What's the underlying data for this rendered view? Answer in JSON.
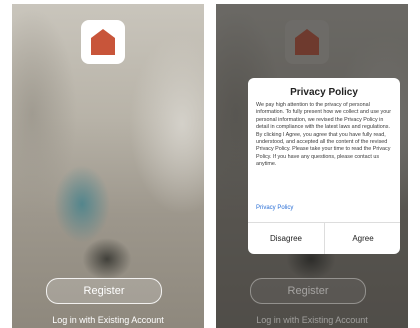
{
  "left_screen": {
    "register_label": "Register",
    "login_label": "Log in with Existing Account"
  },
  "right_screen": {
    "register_label": "Register",
    "login_label": "Log in with Existing Account",
    "dialog": {
      "title": "Privacy Policy",
      "body": "We pay high attention to the privacy of personal information. To fully present how we collect and use your personal information, we revised the Privacy Policy in detail in compliance with the latest laws and regulations. By clicking I Agree, you agree that you have fully read, understood, and accepted all the content of the revised Privacy Policy. Please take your time to read the Privacy Policy. If you have any questions, please contact us anytime.",
      "link": "Privacy Policy",
      "disagree_label": "Disagree",
      "agree_label": "Agree"
    }
  },
  "icons": {
    "app": "house-icon"
  },
  "colors": {
    "accent_icon": "#c8553a",
    "link": "#2a6fd6"
  }
}
